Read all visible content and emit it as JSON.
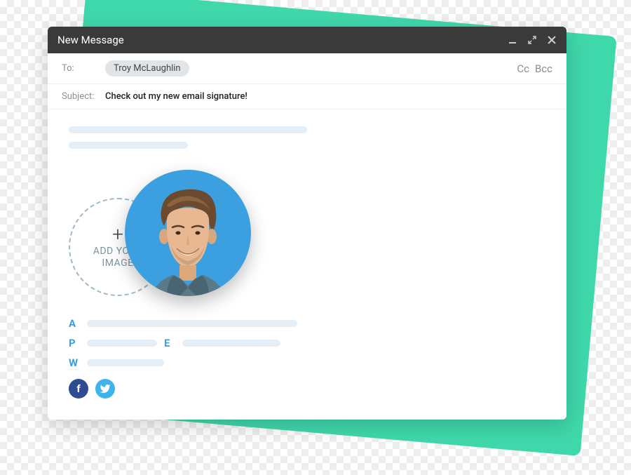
{
  "window": {
    "title": "New Message"
  },
  "to": {
    "label": "To:",
    "recipients": [
      "Troy McLaughlin"
    ],
    "cc_label": "Cc",
    "bcc_label": "Bcc"
  },
  "subject": {
    "label": "Subject:",
    "value": "Check out my new email signature!"
  },
  "signature": {
    "add_image": {
      "plus": "+",
      "line1": "ADD YOUR",
      "line2": "IMAGE"
    },
    "fields": {
      "a": "A",
      "p": "P",
      "e": "E",
      "w": "W"
    },
    "social": {
      "facebook": "f",
      "twitter": "twitter"
    }
  },
  "colors": {
    "accent_teal": "#3fd8aa",
    "accent_blue": "#3b9fe0",
    "facebook": "#2f4b93",
    "twitter": "#3fb4ea"
  }
}
